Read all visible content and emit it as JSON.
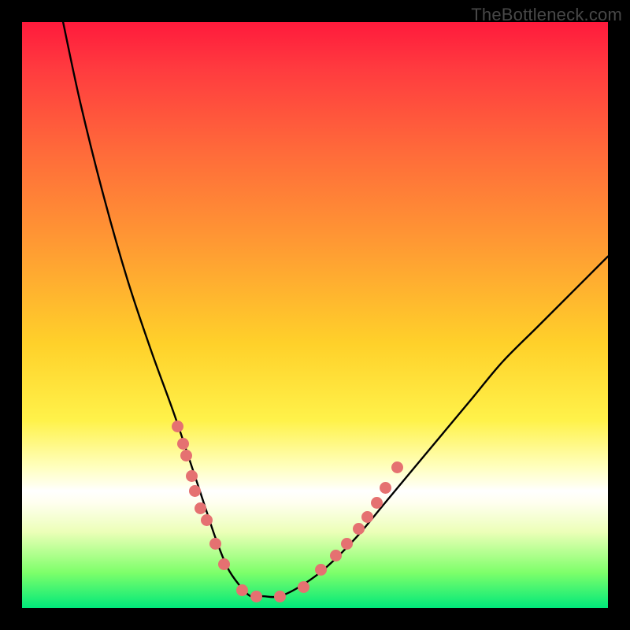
{
  "watermark": "TheBottleneck.com",
  "colors": {
    "frame": "#000000",
    "curve": "#000000",
    "marker": "#e57171",
    "gradient_top": "#ff1a3c",
    "gradient_bottom": "#00e87a"
  },
  "chart_data": {
    "type": "line",
    "title": "",
    "xlabel": "",
    "ylabel": "",
    "xlim": [
      0,
      100
    ],
    "ylim": [
      0,
      100
    ],
    "grid": false,
    "notes": "V-shaped bottleneck curve plotted over a vertical rainbow gradient (red at top through yellow to green at bottom). Y expressed as percent from top of plot area (0 = top/red, 100 = bottom/green). No axis ticks or labels rendered.",
    "series": [
      {
        "name": "bottleneck-curve",
        "x": [
          7,
          10,
          14,
          18,
          22,
          26,
          29,
          31,
          33,
          35,
          37,
          39,
          41,
          44,
          48,
          52,
          57,
          62,
          67,
          72,
          77,
          82,
          88,
          94,
          100
        ],
        "y": [
          0,
          14,
          30,
          44,
          56,
          67,
          76,
          82,
          88,
          93,
          96,
          98,
          98,
          98,
          96,
          93,
          88,
          82,
          76,
          70,
          64,
          58,
          52,
          46,
          40
        ]
      }
    ],
    "markers": {
      "name": "highlight-dots",
      "x": [
        26.5,
        27.5,
        28.0,
        29.0,
        29.5,
        30.5,
        31.5,
        33.0,
        34.5,
        37.5,
        40.0,
        44.0,
        48.0,
        51.0,
        53.5,
        55.5,
        57.5,
        59.0,
        60.5,
        62.0,
        64.0
      ],
      "y": [
        69.0,
        72.0,
        74.0,
        77.5,
        80.0,
        83.0,
        85.0,
        89.0,
        92.5,
        97.0,
        98.0,
        98.0,
        96.5,
        93.5,
        91.0,
        89.0,
        86.5,
        84.5,
        82.0,
        79.5,
        76.0
      ]
    }
  }
}
